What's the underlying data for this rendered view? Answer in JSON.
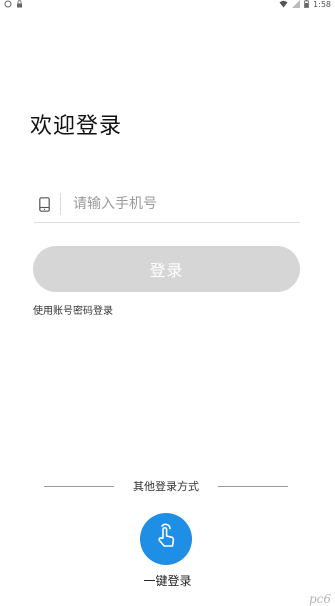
{
  "status_bar": {
    "left_icons": [
      "notification-icon",
      "lock-icon"
    ],
    "right_icons": [
      "wifi-icon",
      "signal-icon",
      "battery-icon"
    ],
    "time": "1:58"
  },
  "welcome_title": "欢迎登录",
  "phone": {
    "placeholder": "请输入手机号",
    "value": "",
    "icon": "phone-icon"
  },
  "login_button": {
    "label": "登录",
    "color": "#d6d6d6"
  },
  "password_login_link": "使用账号密码登录",
  "other_login": {
    "label": "其他登录方式",
    "one_key": {
      "label": "一键登录",
      "icon": "hand-tap-icon",
      "color": "#1f8fe6"
    }
  },
  "watermark": "pc6"
}
